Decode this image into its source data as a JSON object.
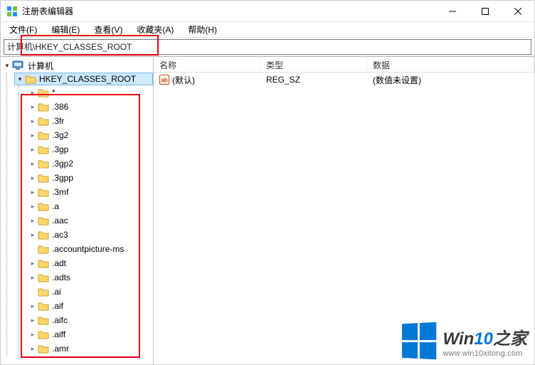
{
  "window": {
    "title": "注册表编辑器"
  },
  "menus": {
    "file": "文件(F)",
    "edit": "编辑(E)",
    "view": "查看(V)",
    "favorites": "收藏夹(A)",
    "help": "帮助(H)"
  },
  "address": {
    "path": "计算机\\HKEY_CLASSES_ROOT"
  },
  "tree": {
    "root": "计算机",
    "selected": "HKEY_CLASSES_ROOT",
    "children": [
      "*",
      ".386",
      ".3fr",
      ".3g2",
      ".3gp",
      ".3gp2",
      ".3gpp",
      ".3mf",
      ".a",
      ".aac",
      ".ac3",
      ".accountpicture-ms",
      ".adt",
      ".adts",
      ".ai",
      ".aif",
      ".aifc",
      ".aiff",
      ".amr"
    ]
  },
  "list": {
    "headers": {
      "name": "名称",
      "type": "类型",
      "data": "数据"
    },
    "rows": [
      {
        "name": "(默认)",
        "type": "REG_SZ",
        "data": "(数值未设置)"
      }
    ]
  },
  "watermark": {
    "brand_pre": "Win",
    "brand_accent": "10",
    "brand_post": "之家",
    "url": "www.win10xitong.com"
  }
}
